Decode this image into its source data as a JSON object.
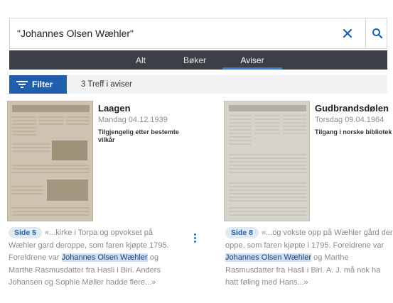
{
  "search": {
    "value": "\"Johannes Olsen Wæhler\"",
    "placeholder": ""
  },
  "tabs": [
    {
      "label": "Alt"
    },
    {
      "label": "Bøker"
    },
    {
      "label": "Aviser"
    }
  ],
  "filter": {
    "button_label": "Filter",
    "hits_text": "3 Treff i aviser"
  },
  "results": [
    {
      "title": "Laagen",
      "date": "Mandag 04.12.1939",
      "access": "Tilgjengelig etter bestemte vilkår",
      "page": "Side 5",
      "snippet_pre": "«...kirke i Torpa og opvokset på Wæhler gard deroppe, som faren kjøpte 1795. Foreldrene var ",
      "snippet_hl": "Johannes Olsen Wæhler",
      "snippet_post": " og Marthe Rasmusdatter fra Hasli i Biri. Anders Johansen og Sophie Møller hadde flere...»"
    },
    {
      "title": "Gudbrandsdølen",
      "date": "Torsdag 09.04.1964",
      "access": "Tilgang i norske bibliotek",
      "page": "Side 8",
      "snippet_pre": "«...og vokste opp på Wæhler gård der oppe, som faren kjøpte i 1795. Foreldrene var ",
      "snippet_hl": "Johannes Olsen Wæhler",
      "snippet_post": " og Marthe Rasmusdatter fra Hasli i Biri. A. J. må nok ha hatt føling med Hans...»"
    }
  ],
  "colors": {
    "primary": "#1f5fae",
    "tabbar": "#3c3f45",
    "highlight": "#cfe0f5"
  }
}
